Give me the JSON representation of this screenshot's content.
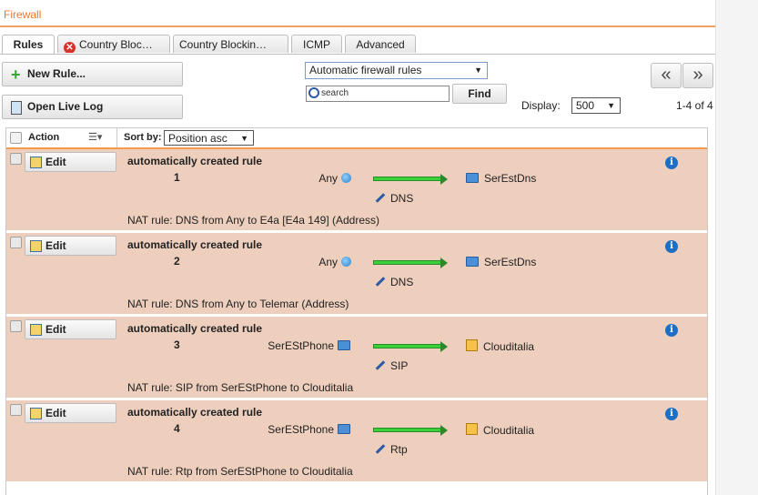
{
  "panel": {
    "title": "Firewall"
  },
  "tabs": [
    {
      "label": "Rules",
      "active": true,
      "error": false
    },
    {
      "label": "Country Bloc…",
      "active": false,
      "error": true
    },
    {
      "label": "Country Blockin…",
      "active": false,
      "error": false
    },
    {
      "label": "ICMP",
      "active": false,
      "error": false
    },
    {
      "label": "Advanced",
      "active": false,
      "error": false
    }
  ],
  "toolbar": {
    "new_rule": "New Rule...",
    "open_live_log": "Open Live Log",
    "rule_filter": "Automatic firewall rules",
    "search_placeholder": "search",
    "find": "Find",
    "display_label": "Display:",
    "display_value": "500",
    "first_page": "«",
    "next_page": "»",
    "count": "1-4 of 4"
  },
  "grid": {
    "action_header": "Action",
    "sort_label": "Sort by:",
    "sort_value": "Position asc"
  },
  "rules": [
    {
      "edit": "Edit",
      "title": "automatically created rule",
      "number": "1",
      "source": "Any",
      "source_icon": "globe-icon",
      "service": "DNS",
      "destination": "SerEstDns",
      "destination_icon": "network-host-icon",
      "nat": "NAT rule: DNS from Any to E4a [E4a 149] (Address)"
    },
    {
      "edit": "Edit",
      "title": "automatically created rule",
      "number": "2",
      "source": "Any",
      "source_icon": "globe-icon",
      "service": "DNS",
      "destination": "SerEstDns",
      "destination_icon": "network-host-icon",
      "nat": "NAT rule: DNS from Any to Telemar (Address)"
    },
    {
      "edit": "Edit",
      "title": "automatically created rule",
      "number": "3",
      "source": "SerEStPhone",
      "source_icon": "network-host-icon",
      "service": "SIP",
      "destination": "Clouditalia",
      "destination_icon": "folder-icon",
      "nat": "NAT rule: SIP from SerEStPhone to Clouditalia"
    },
    {
      "edit": "Edit",
      "title": "automatically created rule",
      "number": "4",
      "source": "SerEStPhone",
      "source_icon": "network-host-icon",
      "service": "Rtp",
      "destination": "Clouditalia",
      "destination_icon": "folder-icon",
      "nat": "NAT rule: Rtp from SerEStPhone to Clouditalia"
    }
  ],
  "colors": {
    "accent": "#e8792e",
    "row_bg": "#eecfbd",
    "arrow": "#38d238",
    "info": "#1d6fc6"
  }
}
